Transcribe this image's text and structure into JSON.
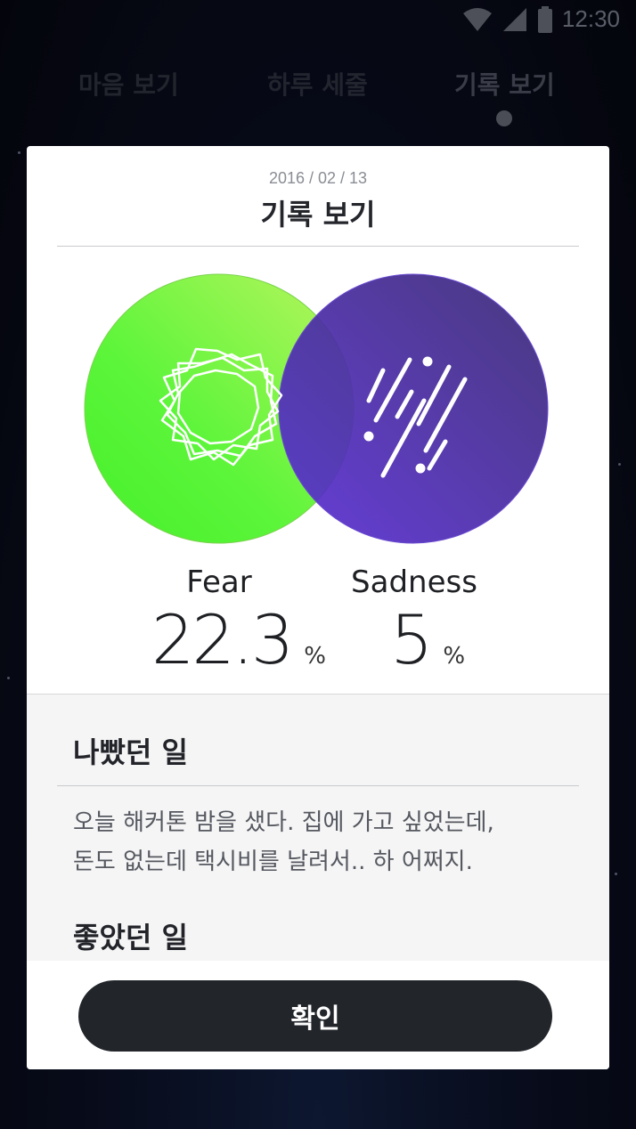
{
  "status_bar": {
    "time": "12:30"
  },
  "tabs": [
    {
      "label": "마음 보기"
    },
    {
      "label": "하루 세줄"
    },
    {
      "label": "기록 보기"
    }
  ],
  "modal": {
    "date": "2016 / 02 / 13",
    "title": "기록 보기",
    "emotions": [
      {
        "name": "Fear",
        "value": "22.3",
        "unit": "%",
        "color": "#5cf53a",
        "icon": "scribble-circle-icon"
      },
      {
        "name": "Sadness",
        "value": "5",
        "unit": "%",
        "color": "#5b2fd6",
        "icon": "rain-lines-icon"
      }
    ],
    "bad_section": {
      "heading": "나빴던 일",
      "text_line1": "오늘 해커톤 밤을 샜다. 집에 가고 싶었는데,",
      "text_line2": "돈도 없는데 택시비를 날려서.. 하 어쩌지."
    },
    "good_section": {
      "heading": "좋았던 일"
    },
    "confirm_label": "확인"
  }
}
